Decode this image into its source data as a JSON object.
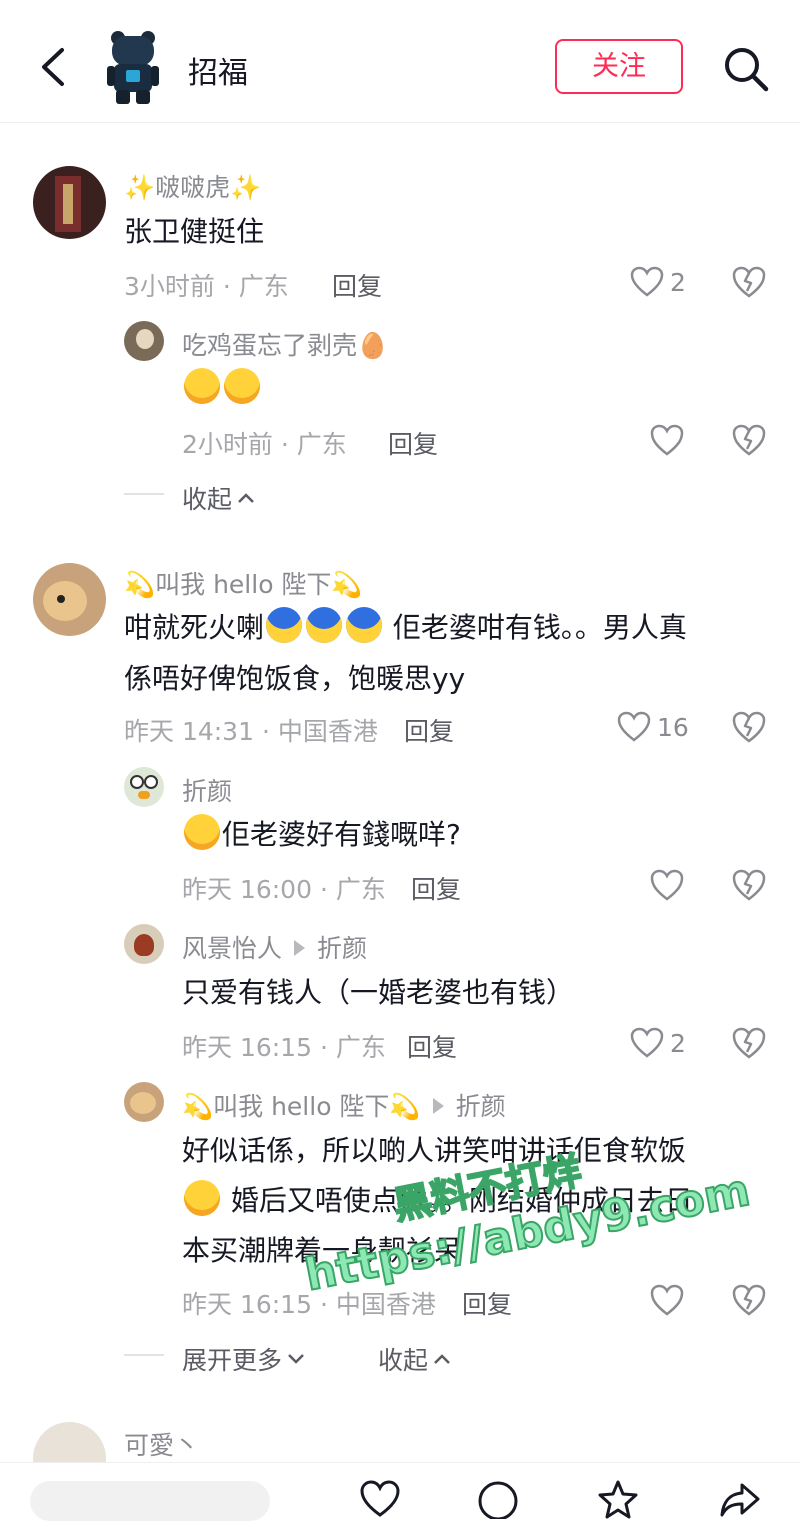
{
  "header": {
    "title": "招福",
    "follow_label": "关注"
  },
  "comments": [
    {
      "name": "✨啵啵虎✨",
      "text": "张卫健挺住",
      "meta": "3小时前 · 广东",
      "reply": "回复",
      "likes": "2",
      "replies": [
        {
          "name": "吃鸡蛋忘了剥壳🥚",
          "meta": "2小时前 · 广东",
          "reply": "回复",
          "likes": ""
        }
      ],
      "collapse": "收起"
    },
    {
      "name": "💫叫我 hello 陛下💫",
      "text1": "咁就死火喇",
      "text1b": " 佢老婆咁有钱。。男人真",
      "text2": "係唔好俾饱饭食，饱暖思yy",
      "meta": "昨天 14:31 · 中国香港",
      "reply": "回复",
      "likes": "16",
      "replies": [
        {
          "name": "折颜",
          "text": "佢老婆好有錢嘅咩?",
          "meta": "昨天 16:00 · 广东",
          "reply": "回复",
          "likes": ""
        },
        {
          "name": "风景怡人",
          "to": "折颜",
          "text": "只爱有钱人（一婚老婆也有钱）",
          "meta": "昨天 16:15 · 广东",
          "reply": "回复",
          "likes": "2"
        },
        {
          "name": "💫叫我 hello 陛下💫",
          "to": "折颜",
          "text1": "好似话係，所以啲人讲笑咁讲话佢食软饭",
          "text2": " 婚后又唔使点做。。刚结婚仲成日去日",
          "text3": "本买潮牌着一身靓衫呆",
          "meta": "昨天 16:15 · 中国香港",
          "reply": "回复",
          "likes": ""
        }
      ],
      "expand": "展开更多",
      "collapse": "收起"
    },
    {
      "name": "可愛丶"
    }
  ],
  "watermark": {
    "line1": "黑料不打烊",
    "line2": "https://abdy9.com"
  },
  "colors": {
    "accent": "#fe2c55",
    "meta": "#a6a7ab",
    "name": "#8a8b91"
  }
}
